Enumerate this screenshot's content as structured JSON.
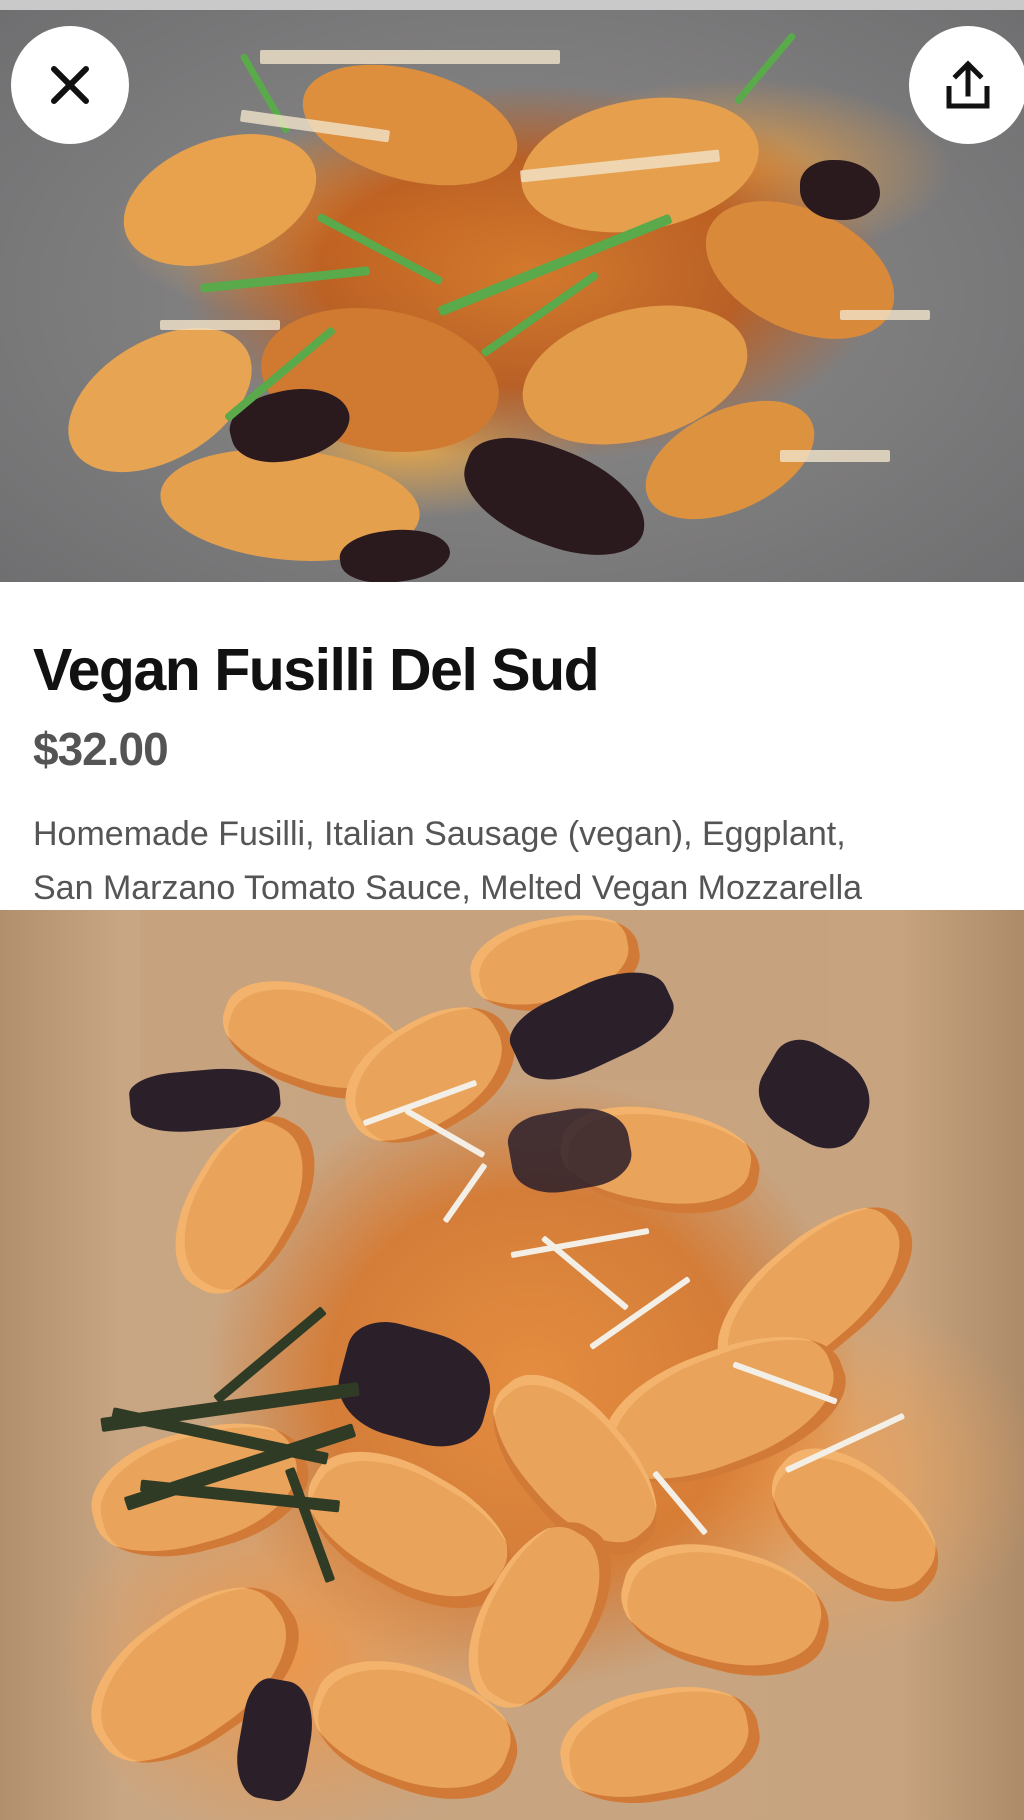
{
  "item": {
    "title": "Vegan Fusilli Del Sud",
    "price": "$32.00",
    "description": "Homemade Fusilli, Italian  Sausage (vegan), Eggplant,\nSan Marzano Tomato Sauce, Melted Vegan Mozzarella"
  },
  "icons": {
    "close": "close-icon",
    "share": "share-icon"
  },
  "colors": {
    "title_text": "#111111",
    "price_text": "#545454",
    "description_text": "#555555",
    "button_background": "#ffffff"
  }
}
